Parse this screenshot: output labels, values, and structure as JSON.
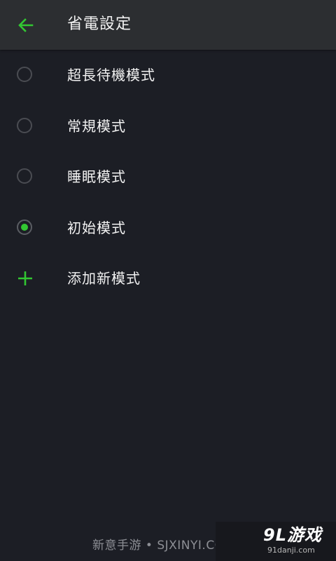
{
  "header": {
    "title": "省電設定",
    "back_icon": "arrow-left-icon"
  },
  "modes": [
    {
      "label": "超長待機模式",
      "selected": false
    },
    {
      "label": "常規模式",
      "selected": false
    },
    {
      "label": "睡眠模式",
      "selected": false
    },
    {
      "label": "初始模式",
      "selected": true
    }
  ],
  "add_mode": {
    "label": "添加新模式",
    "icon": "plus-icon"
  },
  "watermark": {
    "text": "新意手游 • SJXINYI.COM"
  },
  "logo": {
    "main": "9L游戏",
    "sub": "91danji.com"
  },
  "colors": {
    "accent": "#32c732",
    "background": "#1c1e25",
    "topbar": "#2c2e31",
    "text": "#f2f2f2",
    "radio_border": "#4a4c52"
  }
}
